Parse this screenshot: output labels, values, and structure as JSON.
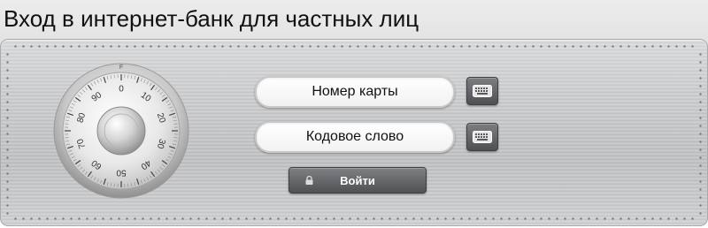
{
  "header": {
    "title": "Вход в интернет-банк для частных лиц"
  },
  "dial": {
    "icon": "safe-combination-dial-icon",
    "marker": "F",
    "numbers": [
      "0",
      "10",
      "20",
      "30",
      "40",
      "50",
      "60",
      "70",
      "80",
      "90"
    ]
  },
  "form": {
    "card_number": {
      "label": "Номер карты",
      "keyboard_icon": "virtual-keyboard-icon"
    },
    "code_word": {
      "label": "Кодовое слово",
      "keyboard_icon": "virtual-keyboard-icon"
    },
    "login_button": {
      "label": "Войти",
      "icon": "lock-icon"
    }
  },
  "colors": {
    "panel": "#c9cacc",
    "button": "#5f6164",
    "button_text": "#ffffff",
    "field_bg": "#ffffff"
  }
}
